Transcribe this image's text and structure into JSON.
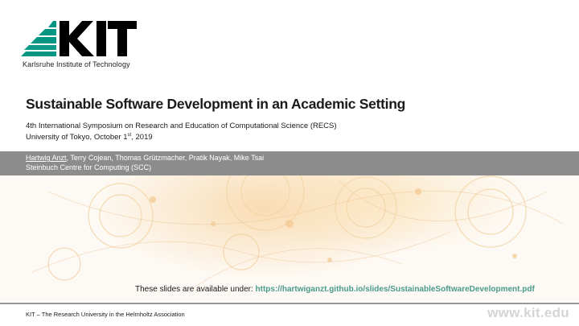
{
  "logo": {
    "name": "KIT",
    "subtitle": "Karlsruhe Institute of Technology",
    "brand_color": "#009682"
  },
  "title": "Sustainable Software Development in an Academic Setting",
  "subtitle_line1": "4th International Symposium  on Research and Education of Computational Science (RECS)",
  "subtitle_line2_prefix": "University of Tokyo, October 1",
  "subtitle_line2_sup": "st",
  "subtitle_line2_suffix": ", 2019",
  "authors": {
    "presenter": "Hartwig Anzt",
    "others": ", Terry Cojean, Thomas Grützmacher, Pratik Nayak, Mike Tsai",
    "affiliation": "Steinbuch Centre for Computing (SCC)",
    "bar_color": "#8c8c8c"
  },
  "slides_note": {
    "prefix": "These slides are available under: ",
    "link": "https://hartwiganzt.github.io/slides/SustainableSoftwareDevelopment.pdf",
    "link_color": "#4a9a8a"
  },
  "footer": {
    "left": "KIT – The Research University in the Helmholtz Association",
    "right": "www.kit.edu"
  }
}
